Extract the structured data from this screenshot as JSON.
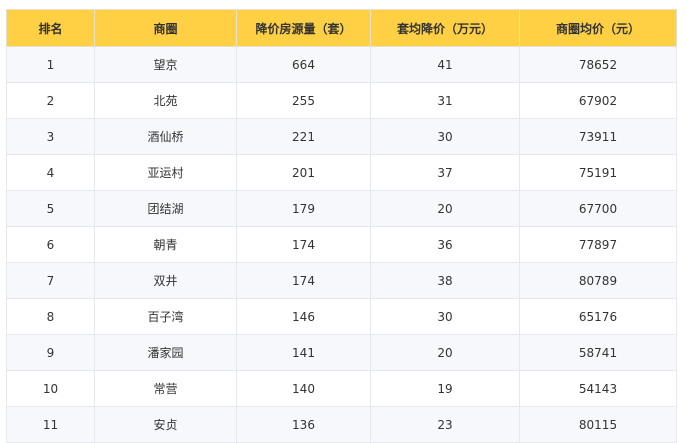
{
  "table": {
    "headers": [
      "排名",
      "商圈",
      "降价房源量（套）",
      "套均降价（万元）",
      "商圈均价（元）"
    ],
    "rows": [
      [
        "1",
        "望京",
        "664",
        "41",
        "78652"
      ],
      [
        "2",
        "北苑",
        "255",
        "31",
        "67902"
      ],
      [
        "3",
        "酒仙桥",
        "221",
        "30",
        "73911"
      ],
      [
        "4",
        "亚运村",
        "201",
        "37",
        "75191"
      ],
      [
        "5",
        "团结湖",
        "179",
        "20",
        "67700"
      ],
      [
        "6",
        "朝青",
        "174",
        "36",
        "77897"
      ],
      [
        "7",
        "双井",
        "174",
        "38",
        "80789"
      ],
      [
        "8",
        "百子湾",
        "146",
        "30",
        "65176"
      ],
      [
        "9",
        "潘家园",
        "141",
        "20",
        "58741"
      ],
      [
        "10",
        "常营",
        "140",
        "19",
        "54143"
      ],
      [
        "11",
        "安贞",
        "136",
        "23",
        "80115"
      ]
    ]
  },
  "colors": {
    "header_bg": "#ffd043",
    "stripe_bg": "#f6f8fc",
    "border": "#e5e8ee"
  }
}
